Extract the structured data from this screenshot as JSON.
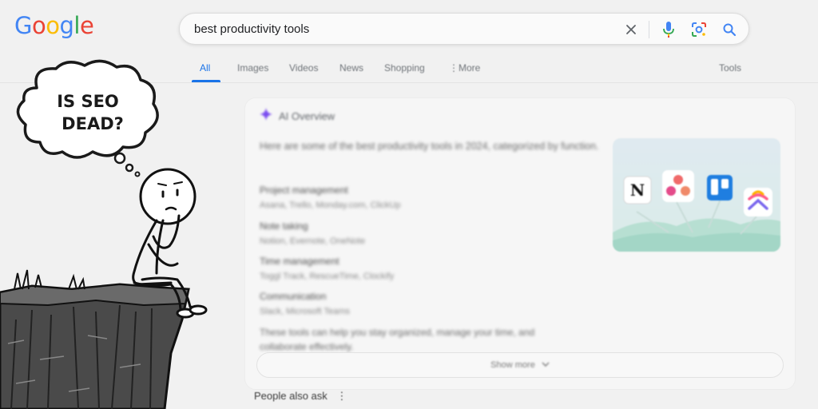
{
  "header": {
    "logo": [
      "G",
      "o",
      "o",
      "g",
      "l",
      "e"
    ],
    "search": {
      "query": "best productivity tools"
    },
    "tabs": [
      {
        "label": "All",
        "active": true
      },
      {
        "label": "Images",
        "active": false
      },
      {
        "label": "Videos",
        "active": false
      },
      {
        "label": "News",
        "active": false
      },
      {
        "label": "Shopping",
        "active": false
      },
      {
        "label": "More",
        "active": false
      }
    ],
    "tools_label": "Tools"
  },
  "overview": {
    "title": "AI Overview",
    "intro": "Here are some of the best productivity tools in 2024, categorized by function.",
    "sections": [
      {
        "heading": "Project management",
        "detail": "Asana, Trello, Monday.com, ClickUp"
      },
      {
        "heading": "Note taking",
        "detail": "Notion, Evernote, OneNote"
      },
      {
        "heading": "Time management",
        "detail": "Toggl Track, RescueTime, Clockify"
      },
      {
        "heading": "Communication",
        "detail": "Slack, Microsoft Teams"
      }
    ],
    "closing": "These tools can help you stay organized, manage your time, and collaborate effectively.",
    "show_more": "Show more"
  },
  "people_also_ask": "People also ask",
  "illustration": {
    "thought": [
      "IS SEO",
      "DEAD?"
    ]
  },
  "colors": {
    "accent": "#1a73e8",
    "google_blue": "#4285f4",
    "google_red": "#ea4335",
    "google_yellow": "#fbbc05",
    "google_green": "#34a853",
    "sparkle": "#7b4df0"
  },
  "icons": {
    "clear": "close-icon",
    "voice": "microphone-icon",
    "lens": "google-lens-icon",
    "search": "search-icon",
    "overview": "sparkle-icon",
    "show_more": "chevron-down-icon"
  }
}
